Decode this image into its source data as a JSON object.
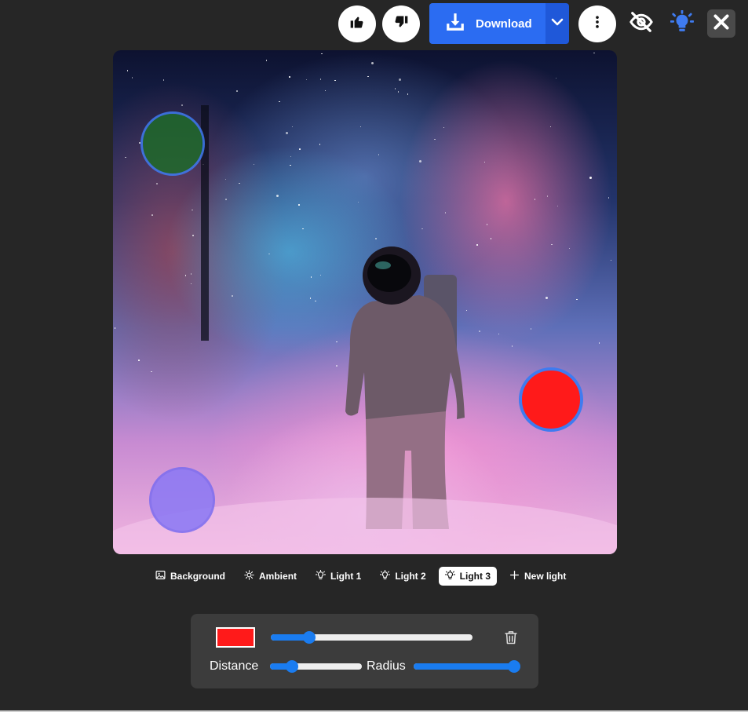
{
  "toolbar": {
    "thumbs_up_icon": "thumbs-up-icon",
    "thumbs_down_icon": "thumbs-down-icon",
    "download_label": "Download",
    "more_icon": "more-vertical-icon",
    "hide_icon": "eye-off-icon",
    "lights_icon": "light-bulb-icon",
    "close_icon": "close-icon"
  },
  "colors": {
    "accent": "#2b6cf2",
    "panel": "#3c3c3c",
    "background": "#262626",
    "light_green": "#1f6a2a",
    "light_purple": "#8a78f5",
    "light_red": "#ff1a1a",
    "handle_border": "#3f7bf0"
  },
  "tabs": [
    {
      "label": "Background",
      "icon": "image-icon",
      "active": false
    },
    {
      "label": "Ambient",
      "icon": "sun-icon",
      "active": false
    },
    {
      "label": "Light 1",
      "icon": "bulb-icon",
      "active": false
    },
    {
      "label": "Light 2",
      "icon": "bulb-icon",
      "active": false
    },
    {
      "label": "Light 3",
      "icon": "bulb-icon",
      "active": true
    },
    {
      "label": "New light",
      "icon": "plus-icon",
      "active": false
    }
  ],
  "panel": {
    "color": "#ff1a1a",
    "intensity": 0.19,
    "distance_label": "Distance",
    "distance": 0.24,
    "radius_label": "Radius",
    "radius": 1.0,
    "delete_icon": "trash-icon"
  }
}
